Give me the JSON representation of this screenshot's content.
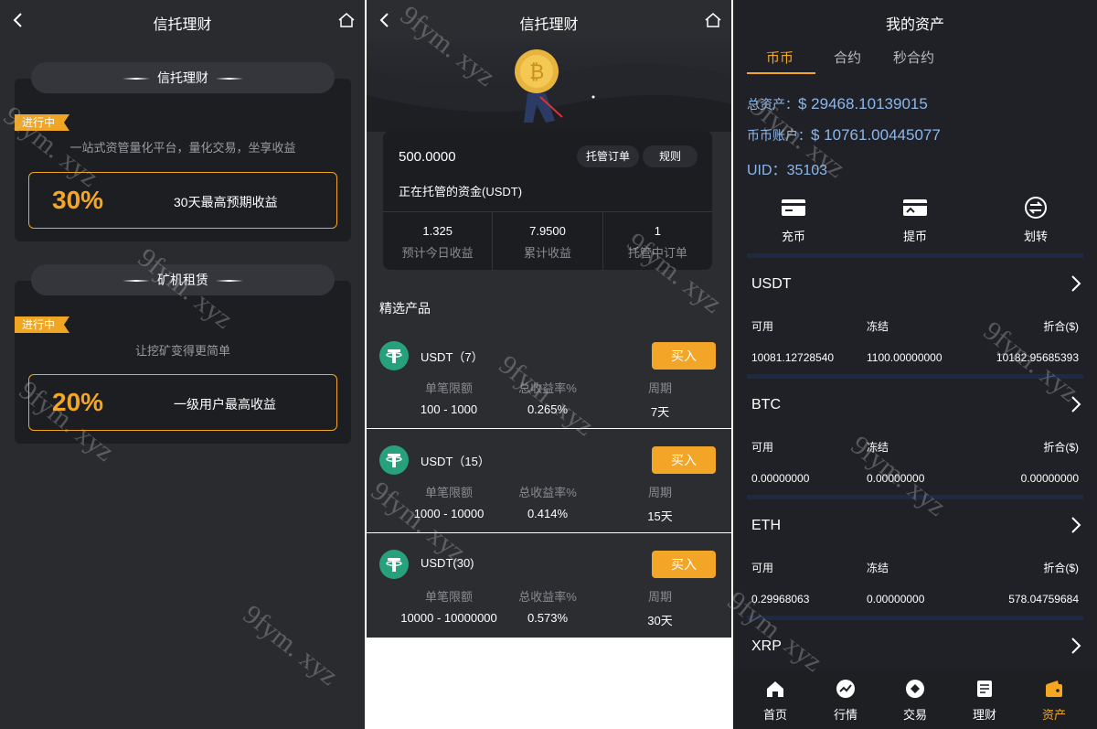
{
  "left": {
    "title": "信托理财",
    "card1": {
      "tab": "信托理财",
      "badge": "进行中",
      "subtitle": "一站式资管量化平台，量化交易，坐享收益",
      "percent": "30%",
      "desc": "30天最高预期收益"
    },
    "card2": {
      "tab": "矿机租赁",
      "badge": "进行中",
      "subtitle": "让挖矿变得更简单",
      "percent": "20%",
      "desc": "一级用户最高收益"
    }
  },
  "middle": {
    "title": "信托理财",
    "holding": {
      "amount": "500.0000",
      "orders_button": "托管订单",
      "rules_button": "规则",
      "label": "正在托管的资金(USDT)",
      "stats": [
        {
          "value": "1.325",
          "label": "预计今日收益"
        },
        {
          "value": "7.9500",
          "label": "累计收益"
        },
        {
          "value": "1",
          "label": "托管中订单"
        }
      ]
    },
    "section_title": "精选产品",
    "products": [
      {
        "name": "USDT（7）",
        "buy": "买入",
        "k1": "单笔限额",
        "v1": "100 - 1000",
        "k2": "总收益率%",
        "v2": "0.265%",
        "k3": "周期",
        "v3": "7天"
      },
      {
        "name": "USDT（15）",
        "buy": "买入",
        "k1": "单笔限额",
        "v1": "1000 - 10000",
        "k2": "总收益率%",
        "v2": "0.414%",
        "k3": "周期",
        "v3": "15天"
      },
      {
        "name": "USDT(30)",
        "buy": "买入",
        "k1": "单笔限额",
        "v1": "10000 - 10000000",
        "k2": "总收益率%",
        "v2": "0.573%",
        "k3": "周期",
        "v3": "30天"
      }
    ]
  },
  "right": {
    "title": "我的资产",
    "tabs": [
      "币币",
      "合约",
      "秒合约"
    ],
    "total_label": "总资产：",
    "total_value": "$ 29468.10139015",
    "account_label": "币币账户：",
    "account_value": "$ 10761.00445077",
    "uid_label": "UID：",
    "uid_value": "35103",
    "actions": [
      "充币",
      "提币",
      "划转"
    ],
    "col_labels": [
      "可用",
      "冻结",
      "折合($)"
    ],
    "assets": [
      {
        "symbol": "USDT",
        "available": "10081.12728540",
        "frozen": "1100.00000000",
        "equiv": "10182.95685393"
      },
      {
        "symbol": "BTC",
        "available": "0.00000000",
        "frozen": "0.00000000",
        "equiv": "0.00000000"
      },
      {
        "symbol": "ETH",
        "available": "0.29968063",
        "frozen": "0.00000000",
        "equiv": "578.04759684"
      },
      {
        "symbol": "XRP"
      }
    ],
    "tabbar": [
      "首页",
      "行情",
      "交易",
      "理财",
      "资产"
    ]
  },
  "watermark": "9fym. xyz",
  "colors": {
    "accent": "#f5a623",
    "usdt": "#26a17b",
    "link": "#8db6e8"
  }
}
